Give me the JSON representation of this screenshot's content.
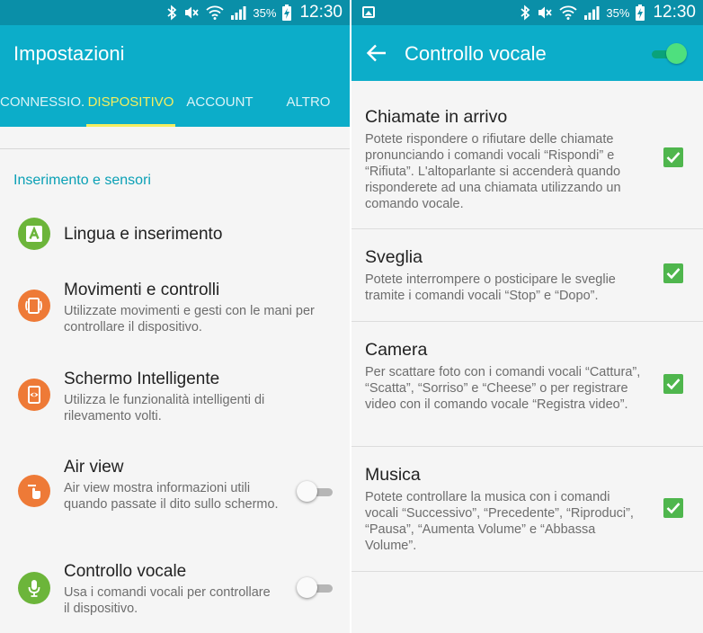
{
  "status": {
    "battery_percent": "35%",
    "time": "12:30"
  },
  "left_screen": {
    "title": "Impostazioni",
    "tabs": [
      {
        "label": "CONNESSIO..",
        "active": false
      },
      {
        "label": "DISPOSITIVO",
        "active": true
      },
      {
        "label": "ACCOUNT",
        "active": false
      },
      {
        "label": "ALTRO",
        "active": false
      }
    ],
    "section_header": "Inserimento e sensori",
    "items": [
      {
        "title": "Lingua e inserimento",
        "description": "",
        "icon": "language-icon",
        "icon_color": "#6cb53a"
      },
      {
        "title": "Movimenti e controlli",
        "description": "Utilizzate movimenti e gesti con le mani per controllare il dispositivo.",
        "icon": "motion-icon",
        "icon_color": "#ee7a37"
      },
      {
        "title": "Schermo Intelligente",
        "description": "Utilizza le funzionalità intelligenti di rilevamento volti.",
        "icon": "smart-screen-icon",
        "icon_color": "#ee7a37"
      },
      {
        "title": "Air view",
        "description": "Air view mostra informazioni utili quando passate il dito sullo schermo.",
        "icon": "hand-icon",
        "icon_color": "#ee7a37",
        "toggle": false
      },
      {
        "title": "Controllo vocale",
        "description": "Usa i comandi vocali per controllare il dispositivo.",
        "icon": "microphone-icon",
        "icon_color": "#6cb53a",
        "toggle": false
      }
    ]
  },
  "right_screen": {
    "title": "Controllo vocale",
    "master_toggle": true,
    "items": [
      {
        "title": "Chiamate in arrivo",
        "description": "Potete rispondere o rifiutare delle chiamate pronunciando i comandi vocali “Rispondi” e “Rifiuta”. L'altoparlante si accenderà quando risponderete ad una chiamata utilizzando un comando vocale.",
        "checked": true
      },
      {
        "title": "Sveglia",
        "description": "Potete interrompere o posticipare le sveglie tramite i comandi vocali “Stop” e “Dopo”.",
        "checked": true
      },
      {
        "title": "Camera",
        "description": "Per scattare foto con i comandi vocali “Cattura”, “Scatta”, “Sorriso” e “Cheese” o per registrare video con il comando vocale “Registra video”.",
        "checked": true
      },
      {
        "title": "Musica",
        "description": "Potete controllare la musica con i comandi vocali “Successivo”, “Precedente”, “Riproduci”, “Pausa”, “Aumenta Volume” e “Abbassa Volume”.",
        "checked": true
      }
    ]
  },
  "colors": {
    "status_bar": "#0a8fa8",
    "app_bar": "#0cadc9",
    "tab_active": "#f3ee60",
    "section_header": "#0aa0b5",
    "checkbox": "#4fb64d",
    "toggle_on": "#4ee07e"
  }
}
